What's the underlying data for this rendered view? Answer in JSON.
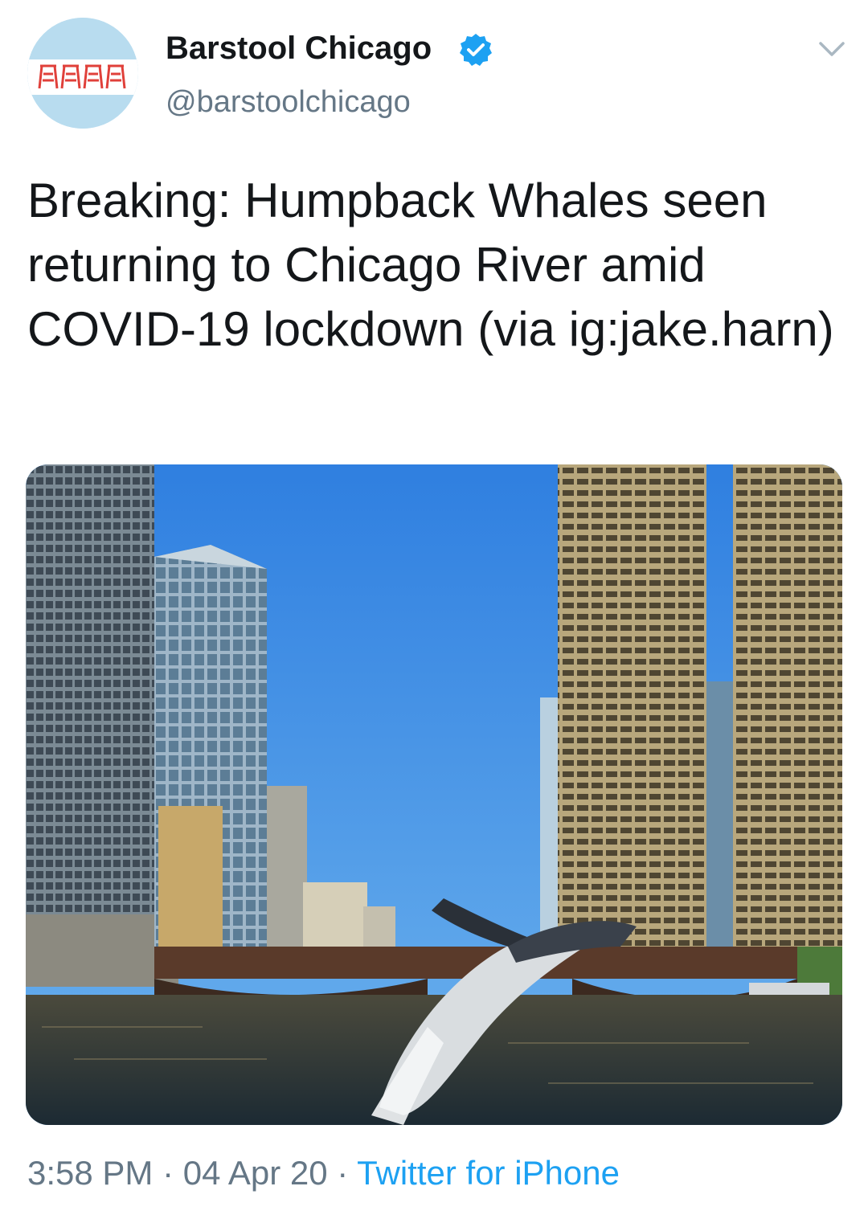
{
  "author": {
    "display_name": "Barstool Chicago",
    "handle": "@barstoolchicago",
    "verified": true,
    "avatar_icon": "barstool-stools-logo"
  },
  "tweet": {
    "text": "Breaking: Humpback Whales seen returning to Chicago River amid COVID-19 lockdown (via ig:jake.harn)"
  },
  "media": {
    "alt": "Humpback whale breaching in the Chicago River between skyscrapers"
  },
  "meta": {
    "time": "3:58 PM",
    "separator": "·",
    "date": "04 Apr 20",
    "source": "Twitter for iPhone"
  },
  "colors": {
    "accent": "#1da1f2",
    "secondary_text": "#657786",
    "avatar_bg": "#b8dcef",
    "logo_red": "#e0403a"
  },
  "icons": {
    "verified": "verified-badge-icon",
    "menu": "chevron-down-icon"
  }
}
